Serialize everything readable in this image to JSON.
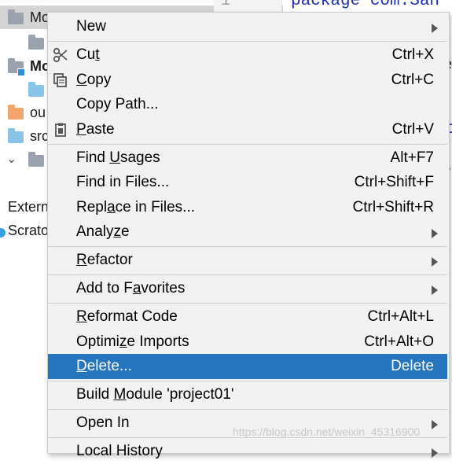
{
  "project_tree": {
    "rows": [
      {
        "label": "Mo",
        "bold": false,
        "selected": true
      },
      {
        "label": "",
        "bold": false
      },
      {
        "label": "Mo",
        "bold": true
      },
      {
        "label": "",
        "bold": false
      },
      {
        "label": "ou",
        "bold": false
      },
      {
        "label": "src",
        "bold": false
      },
      {
        "label": "",
        "bold": false
      },
      {
        "label": "Extern",
        "bold": false
      },
      {
        "label": "Scrato",
        "bold": false
      }
    ]
  },
  "editor": {
    "gutter_line": "1",
    "code_line": "package com.San",
    "frag_e": "e",
    "frag_t": "t",
    "frag_dot": "."
  },
  "context_menu": {
    "items": [
      {
        "label": "New",
        "mnemonic": "",
        "shortcut": "",
        "submenu": true
      },
      {
        "label": "Cut",
        "mnemonic_index": 2,
        "shortcut": "Ctrl+X",
        "icon": "scissors-icon"
      },
      {
        "label": "Copy",
        "mnemonic_index": 0,
        "shortcut": "Ctrl+C",
        "icon": "copy-icon"
      },
      {
        "label": "Copy Path...",
        "shortcut": ""
      },
      {
        "label": "Paste",
        "mnemonic_index": 0,
        "shortcut": "Ctrl+V",
        "icon": "clipboard-icon"
      },
      {
        "label": "Find Usages",
        "mnemonic_index": 5,
        "shortcut": "Alt+F7"
      },
      {
        "label": "Find in Files...",
        "shortcut": "Ctrl+Shift+F"
      },
      {
        "label": "Replace in Files...",
        "mnemonic_index": 4,
        "shortcut": "Ctrl+Shift+R"
      },
      {
        "label": "Analyze",
        "mnemonic_index": 5,
        "shortcut": "",
        "submenu": true
      },
      {
        "label": "Refactor",
        "mnemonic_index": 0,
        "shortcut": "",
        "submenu": true
      },
      {
        "label": "Add to Favorites",
        "mnemonic_index": 8,
        "shortcut": "",
        "submenu": true
      },
      {
        "label": "Reformat Code",
        "mnemonic_index": 0,
        "shortcut": "Ctrl+Alt+L"
      },
      {
        "label": "Optimize Imports",
        "mnemonic_index": 6,
        "shortcut": "Ctrl+Alt+O"
      },
      {
        "label": "Delete...",
        "mnemonic_index": 0,
        "shortcut": "Delete",
        "selected": true
      },
      {
        "label": "Build Module 'project01'",
        "mnemonic_index": 6,
        "shortcut": ""
      },
      {
        "label": "Open In",
        "shortcut": "",
        "submenu": true
      },
      {
        "label": "Local History",
        "shortcut": "",
        "submenu": true
      }
    ]
  },
  "watermark": "https://blog.csdn.net/weixin_45316900",
  "colors": {
    "selection": "#2675bf",
    "menu_bg": "#f2f2f2",
    "keyword": "#1f2fa8"
  }
}
